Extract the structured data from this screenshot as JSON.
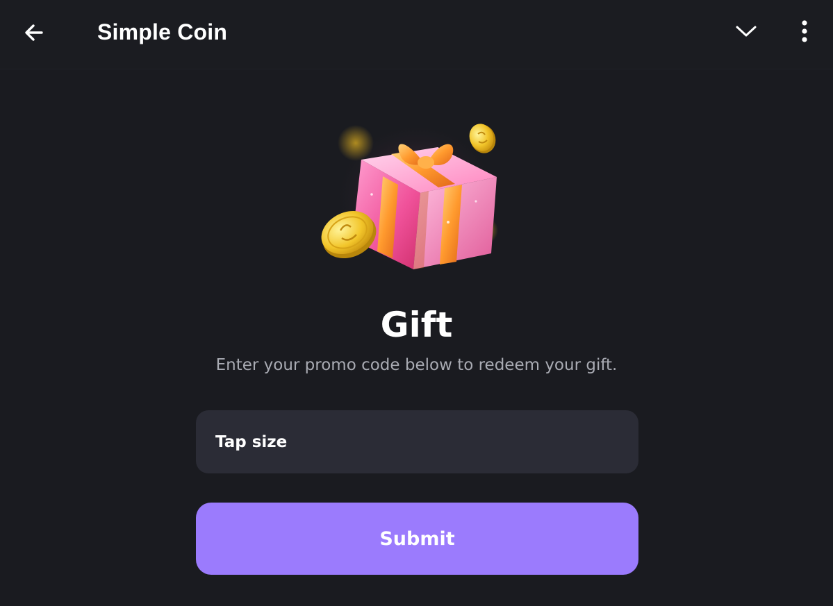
{
  "header": {
    "title": "Simple Coin",
    "back_icon": "arrow-left-icon",
    "collapse_icon": "chevron-down-icon",
    "menu_icon": "more-vertical-icon"
  },
  "hero": {
    "image": "gift-box-with-coins",
    "icon": "gift-icon"
  },
  "main": {
    "title": "Gift",
    "subtitle": "Enter your promo code below to redeem your gift.",
    "promo_input": {
      "placeholder": "Tap size",
      "value": ""
    },
    "submit_label": "Submit"
  },
  "colors": {
    "background": "#1a1b20",
    "input_background": "#2b2c36",
    "accent": "#9b7bfd",
    "subtitle": "#a9abb3",
    "text": "#ffffff"
  }
}
